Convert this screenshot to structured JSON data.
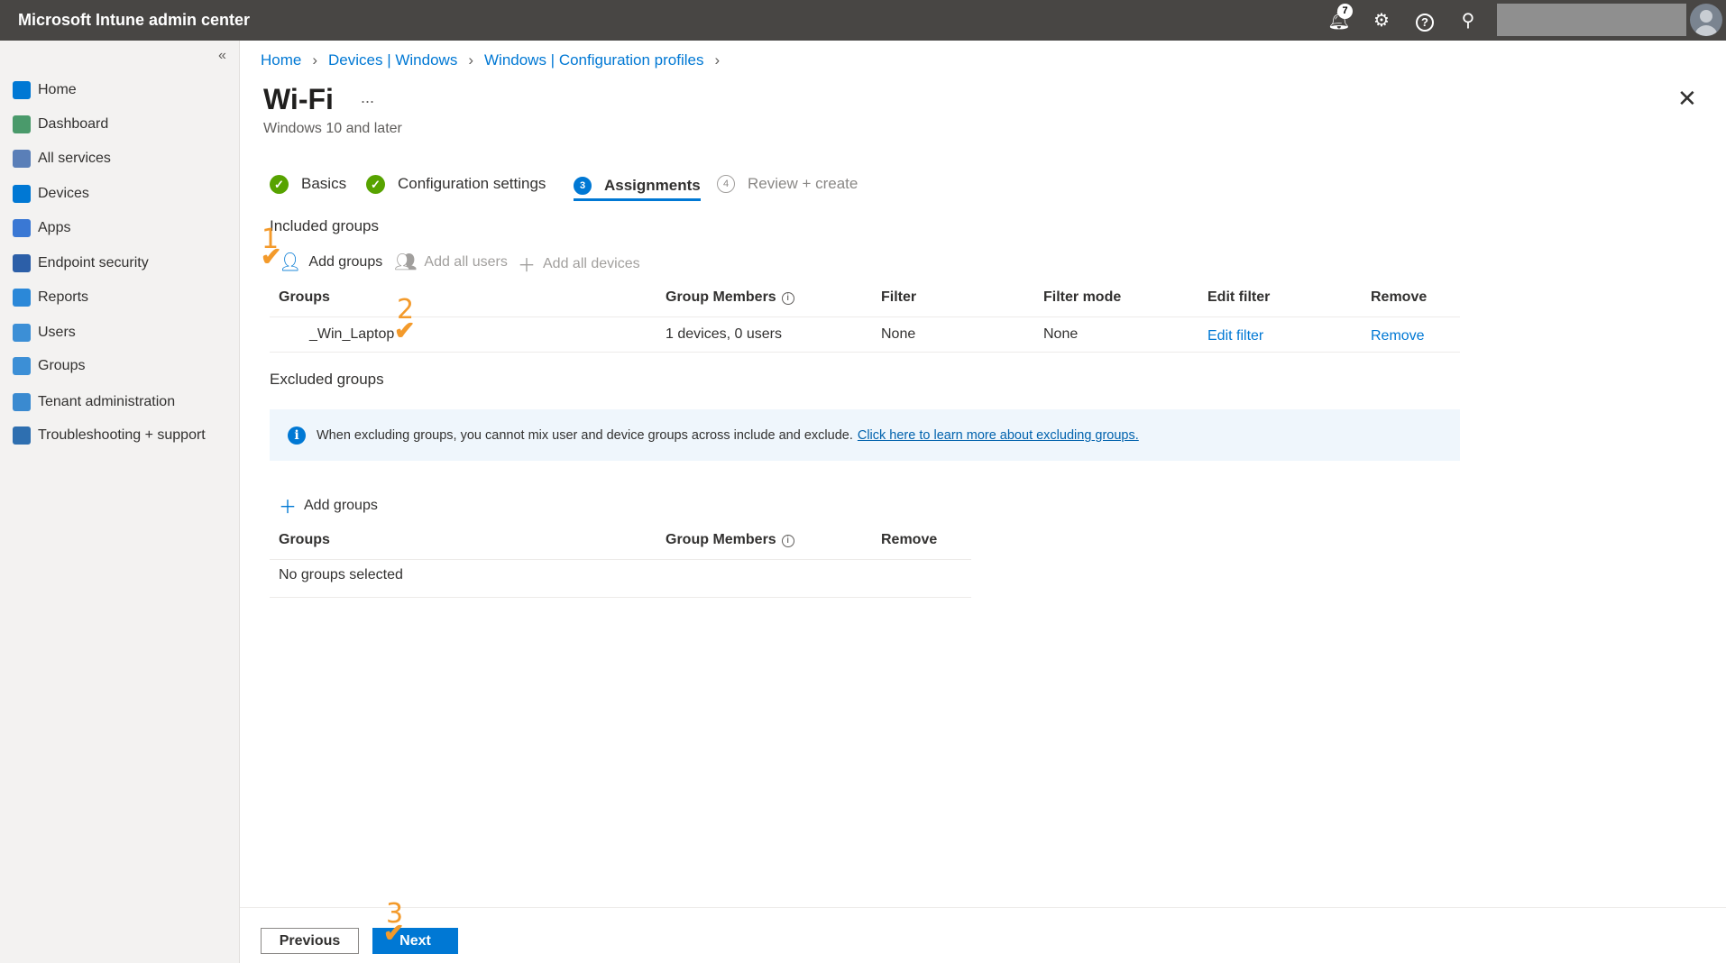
{
  "app": {
    "title": "Microsoft Intune admin center",
    "notification_count": "7"
  },
  "sidebar": {
    "items": [
      {
        "label": "Home",
        "color": "#0078d4"
      },
      {
        "label": "Dashboard",
        "color": "#4a9a6b"
      },
      {
        "label": "All services",
        "color": "#5a7fb8"
      },
      {
        "label": "Devices",
        "color": "#0078d4"
      },
      {
        "label": "Apps",
        "color": "#3a78d4"
      },
      {
        "label": "Endpoint security",
        "color": "#2c5fa8"
      },
      {
        "label": "Reports",
        "color": "#2b88d8"
      },
      {
        "label": "Users",
        "color": "#3c8fd6"
      },
      {
        "label": "Groups",
        "color": "#3c8fd6"
      },
      {
        "label": "Tenant administration",
        "color": "#3a8ad0"
      },
      {
        "label": "Troubleshooting + support",
        "color": "#2e6fb0"
      }
    ]
  },
  "breadcrumb": [
    "Home",
    "Devices | Windows",
    "Windows | Configuration profiles"
  ],
  "page": {
    "title": "Wi-Fi",
    "more": "...",
    "subtitle": "Windows 10 and later"
  },
  "steps": [
    {
      "label": "Basics"
    },
    {
      "label": "Configuration settings"
    },
    {
      "num": "3",
      "label": "Assignments"
    },
    {
      "num": "4",
      "label": "Review + create"
    }
  ],
  "included": {
    "heading": "Included groups",
    "commands": [
      "Add groups",
      "Add all users",
      "Add all devices"
    ],
    "columns": [
      "Groups",
      "Group Members",
      "Filter",
      "Filter mode",
      "Edit filter",
      "Remove"
    ],
    "rows": [
      {
        "group": "_Win_Laptop",
        "members": "1 devices, 0 users",
        "filter": "None",
        "filter_mode": "None",
        "edit": "Edit filter",
        "remove": "Remove"
      }
    ]
  },
  "excluded": {
    "heading": "Excluded groups",
    "info": "When excluding groups, you cannot mix user and device groups across include and exclude.",
    "info_link": "Click here to learn more about excluding groups.",
    "add": "Add groups",
    "columns": [
      "Groups",
      "Group Members",
      "Remove"
    ],
    "empty": "No groups selected"
  },
  "footer": {
    "previous": "Previous",
    "next": "Next"
  },
  "annotations": [
    "1",
    "2",
    "3"
  ]
}
